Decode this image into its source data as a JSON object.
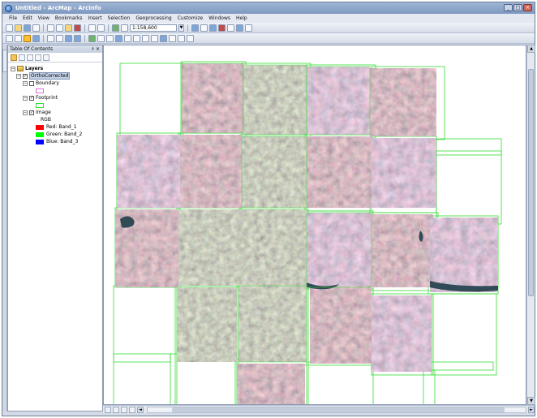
{
  "window": {
    "title": "Untitled - ArcMap - ArcInfo"
  },
  "menu": [
    "File",
    "Edit",
    "View",
    "Bookmarks",
    "Insert",
    "Selection",
    "Geoprocessing",
    "Customize",
    "Windows",
    "Help"
  ],
  "toolbar": {
    "scale_value": "1:158,600"
  },
  "toc": {
    "title": "Table Of Contents",
    "pin_glyph": "2",
    "close_glyph": "×",
    "root_label": "Layers",
    "group_label": "OrthoCorrected",
    "layers": [
      {
        "label": "Boundary",
        "checked": false
      },
      {
        "label": "Footprint",
        "checked": true
      },
      {
        "label": "Image",
        "checked": true
      }
    ],
    "rgb_label": "RGB",
    "bands": [
      {
        "label": "Red:   Band_1",
        "color": "#ff0000"
      },
      {
        "label": "Green: Band_2",
        "color": "#00ff00"
      },
      {
        "label": "Blue:   Band_3",
        "color": "#0000ff"
      }
    ]
  },
  "colors": {
    "footprint": "#33dd33",
    "boundary": "#e070e0",
    "frame_bg": "#d4dbe6"
  },
  "scroll": {
    "up_glyph": "▲",
    "down_glyph": "▼",
    "left_glyph": "◄",
    "right_glyph": "►"
  }
}
